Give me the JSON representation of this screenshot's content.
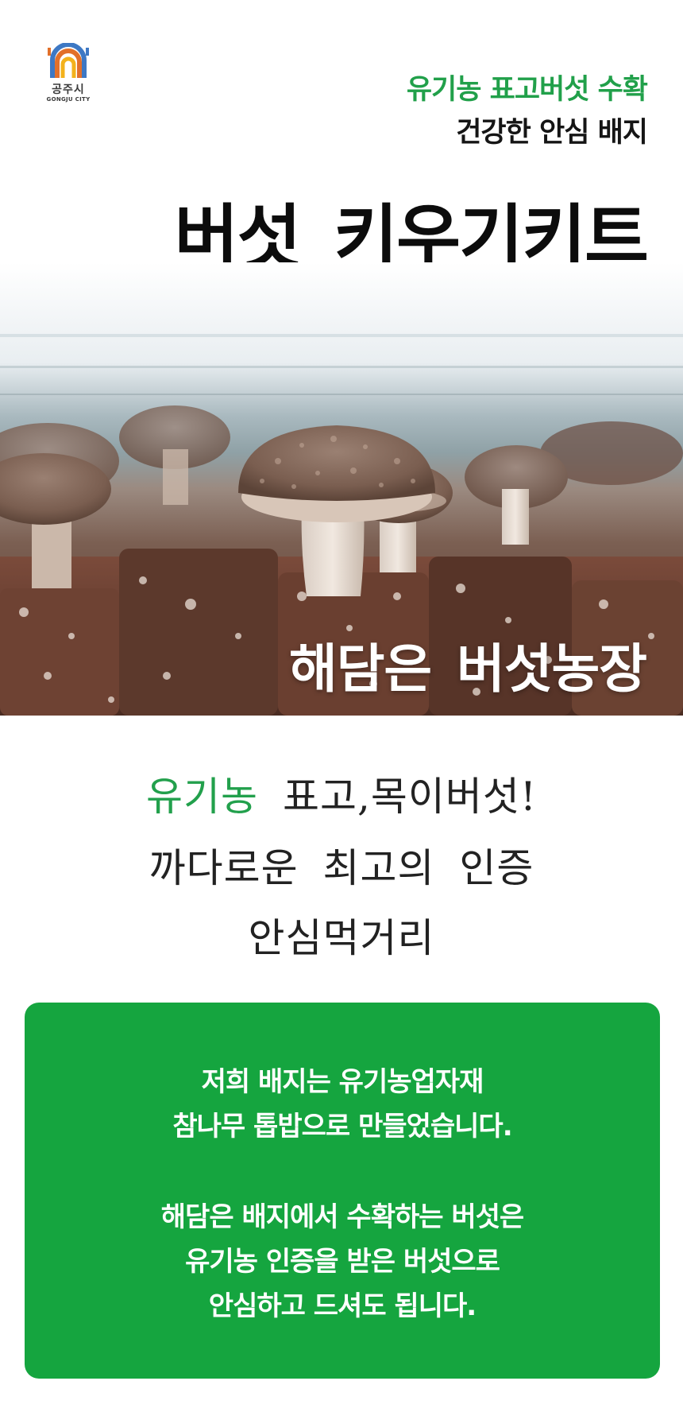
{
  "header": {
    "logo_kr": "공주시",
    "logo_en": "GONGJU CITY",
    "tagline_green": "유기농 표고버섯 수확",
    "tagline_black": "건강한 안심 배지",
    "title": "버섯 키우기키트"
  },
  "hero": {
    "caption": "해담은 버섯농장"
  },
  "slogan": {
    "line1_highlight": "유기농",
    "line1_rest": "표고,목이버섯!",
    "line2": "까다로운 최고의 인증",
    "line3": "안심먹거리"
  },
  "info_box": {
    "line1": "저희 배지는 유기농업자재",
    "line2": "참나무 톱밥으로 만들었습니다.",
    "line3": "해담은 배지에서 수확하는 버섯은",
    "line4": "유기농 인증을 받은 버섯으로",
    "line5": "안심하고 드셔도 됩니다."
  },
  "colors": {
    "brand_green": "#21a04a",
    "box_green": "#15a53f",
    "logo_orange": "#e2702a",
    "logo_blue": "#3d78c4",
    "logo_yellow": "#f3b21c"
  },
  "icons": {
    "logo": "gongju-city-gate-logo"
  }
}
